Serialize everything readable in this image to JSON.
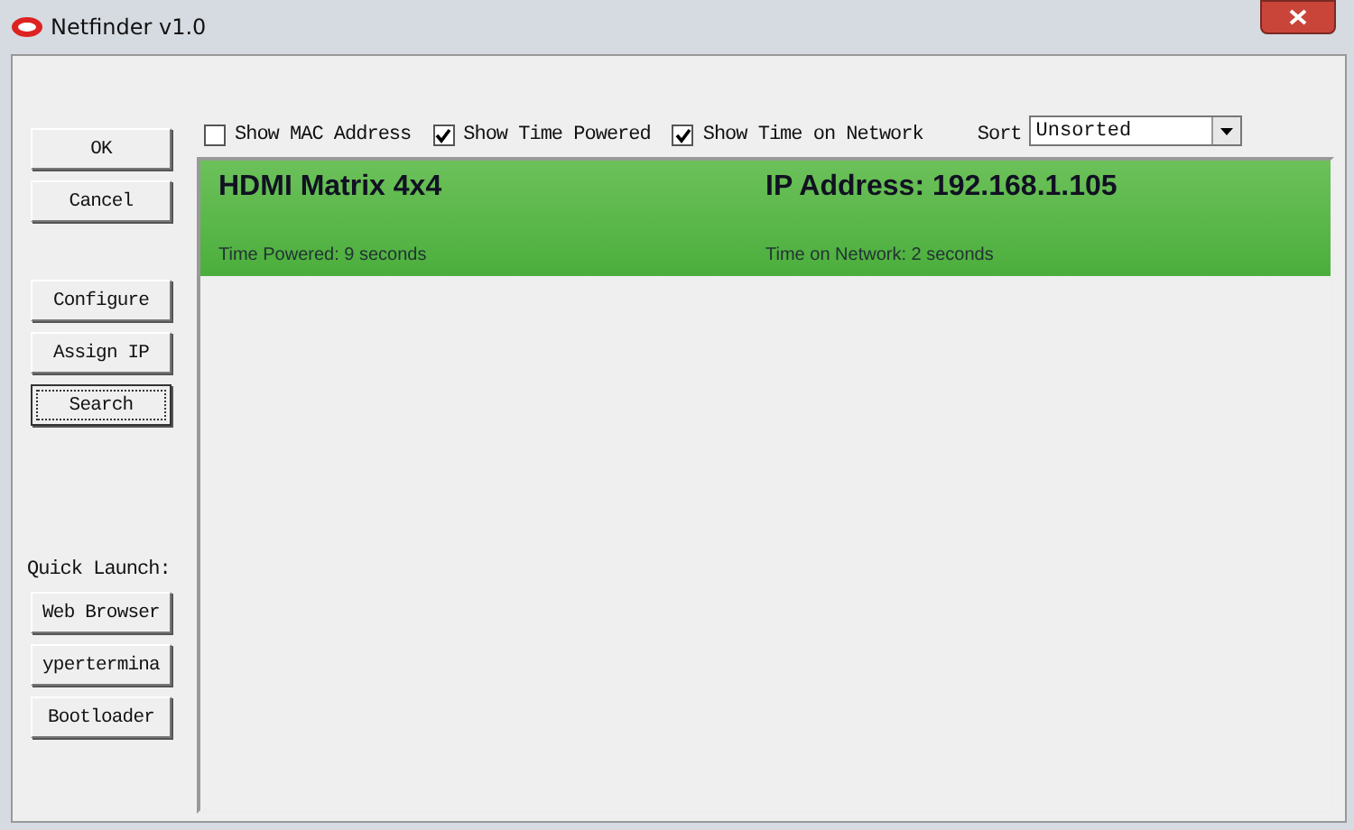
{
  "window": {
    "title": "Netfinder v1.0"
  },
  "options": [
    {
      "label": "Show MAC Address",
      "checked": false
    },
    {
      "label": "Show Time Powered",
      "checked": true
    },
    {
      "label": "Show Time on Network",
      "checked": true
    }
  ],
  "sort": {
    "label": "Sort",
    "value": "Unsorted"
  },
  "button_groups": [
    {
      "buttons": [
        {
          "label": "OK",
          "focused": false
        },
        {
          "label": "Cancel",
          "focused": false
        }
      ]
    },
    {
      "buttons": [
        {
          "label": "Configure",
          "focused": false
        },
        {
          "label": "Assign IP",
          "focused": false
        },
        {
          "label": "Search",
          "focused": true
        }
      ]
    },
    {
      "heading": "Quick Launch:",
      "buttons": [
        {
          "label": "Web Browser",
          "focused": false
        },
        {
          "label": "ypertermina",
          "focused": false
        },
        {
          "label": "Bootloader",
          "focused": false
        }
      ]
    }
  ],
  "devices": [
    {
      "name": "HDMI Matrix 4x4",
      "ip": "IP Address: 192.168.1.105",
      "time_powered": "Time Powered:  9 seconds",
      "time_on_network": "Time on Network:  2 seconds",
      "selected": true
    }
  ]
}
